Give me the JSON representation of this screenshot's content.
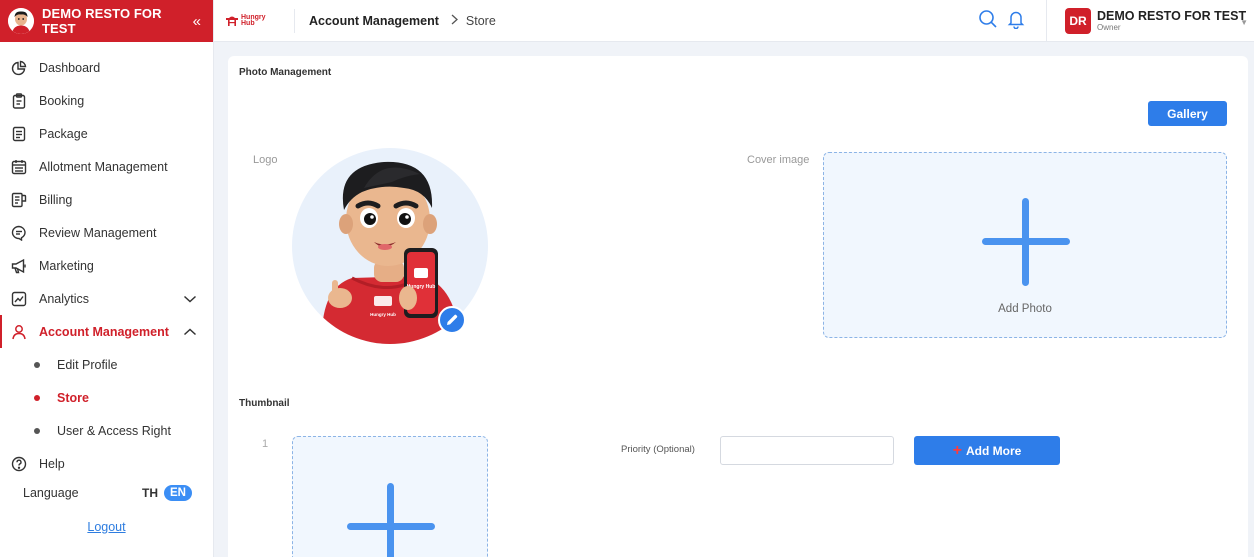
{
  "sidebar": {
    "brand_name": "DEMO RESTO FOR TEST",
    "collapse_glyph": "«",
    "items": [
      {
        "label": "Dashboard",
        "icon": "pie-chart-icon"
      },
      {
        "label": "Booking",
        "icon": "clipboard-icon"
      },
      {
        "label": "Package",
        "icon": "document-icon"
      },
      {
        "label": "Allotment Management",
        "icon": "calendar-icon"
      },
      {
        "label": "Billing",
        "icon": "receipt-icon"
      },
      {
        "label": "Review Management",
        "icon": "message-icon"
      },
      {
        "label": "Marketing",
        "icon": "megaphone-icon"
      },
      {
        "label": "Analytics",
        "icon": "chart-line-icon"
      },
      {
        "label": "Account Management",
        "icon": "user-icon"
      }
    ],
    "sub_items": [
      {
        "label": "Edit Profile"
      },
      {
        "label": "Store"
      },
      {
        "label": "User & Access Right"
      }
    ],
    "help_label": "Help",
    "language_label": "Language",
    "lang_th": "TH",
    "lang_en": "EN",
    "logout_label": "Logout"
  },
  "topbar": {
    "logo_text_1": "Hungry",
    "logo_text_2": "Hub",
    "breadcrumb": [
      "Account Management",
      "Store"
    ],
    "user_initials": "DR",
    "user_name": "DEMO RESTO FOR TEST",
    "user_role": "Owner"
  },
  "content": {
    "photo_section_title": "Photo Management",
    "gallery_label": "Gallery",
    "logo_label": "Logo",
    "cover_label": "Cover image",
    "add_photo_label": "Add Photo",
    "thumbnail_section_title": "Thumbnail",
    "thumbnail_index": "1",
    "priority_label": "Priority (Optional)",
    "priority_value": "",
    "add_more_label": "Add More",
    "mascot_phone_text": "Hungry Hub",
    "mascot_shirt_text": "Hungry Hub"
  },
  "colors": {
    "brand_red": "#d0202a",
    "primary_blue": "#2e7de9",
    "upload_bg": "#f1f7fe"
  }
}
